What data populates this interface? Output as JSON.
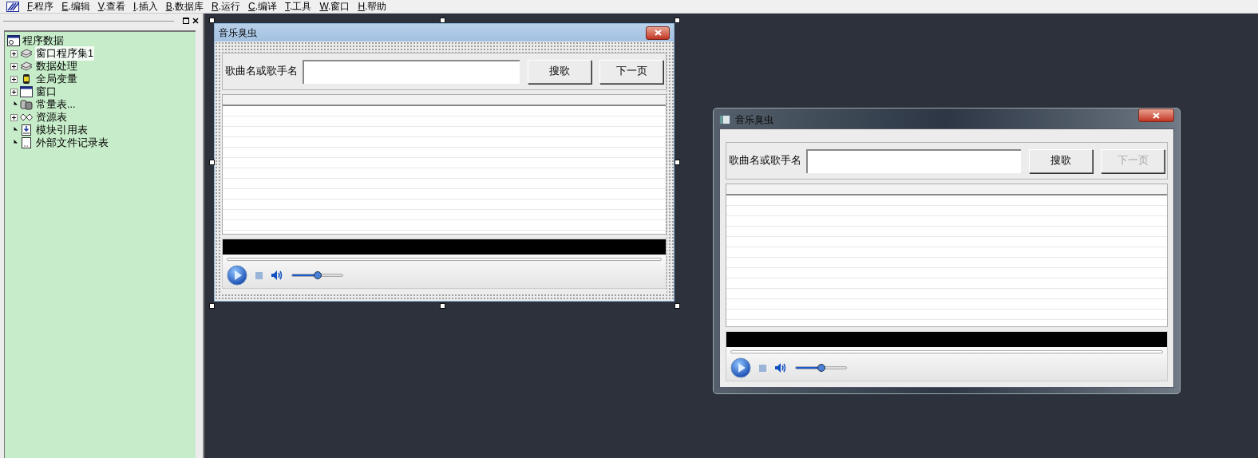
{
  "menu": [
    {
      "label": "F.程序"
    },
    {
      "label": "E.编辑"
    },
    {
      "label": "V.查看"
    },
    {
      "label": "I.插入"
    },
    {
      "label": "B.数据库"
    },
    {
      "label": "R.运行"
    },
    {
      "label": "C.编译"
    },
    {
      "label": "T.工具"
    },
    {
      "label": "W.窗口"
    },
    {
      "label": "H.帮助"
    }
  ],
  "tree": {
    "label": "程序数据",
    "children": [
      {
        "label": "窗口程序集1",
        "kind": "module",
        "collapsed": true,
        "selected": true
      },
      {
        "label": "数据处理",
        "kind": "module",
        "collapsed": true,
        "selected": false
      },
      {
        "label": "全局变量",
        "kind": "variable",
        "collapsed": true,
        "selected": false
      },
      {
        "label": "窗口",
        "kind": "window",
        "collapsed": true,
        "selected": false
      },
      {
        "label": "常量表...",
        "kind": "constants",
        "collapsed": false,
        "selected": false
      },
      {
        "label": "资源表",
        "kind": "resource",
        "collapsed": true,
        "selected": false
      },
      {
        "label": "模块引用表",
        "kind": "reference",
        "collapsed": false,
        "selected": false
      },
      {
        "label": "外部文件记录表",
        "kind": "file",
        "collapsed": false,
        "selected": false
      }
    ]
  },
  "windows": [
    {
      "kind": "designer",
      "title": "音乐臭虫",
      "search_label": "歌曲名或歌手名",
      "buttons": [
        {
          "label": "搜歌",
          "disabled": false
        },
        {
          "label": "下一页",
          "disabled": false
        }
      ],
      "volume": {
        "level": 0.5
      }
    },
    {
      "kind": "runtime",
      "title": "音乐臭虫",
      "search_label": "歌曲名或歌手名",
      "buttons": [
        {
          "label": "搜歌",
          "disabled": false
        },
        {
          "label": "下一页",
          "disabled": true
        }
      ],
      "volume": {
        "level": 0.5
      }
    }
  ]
}
